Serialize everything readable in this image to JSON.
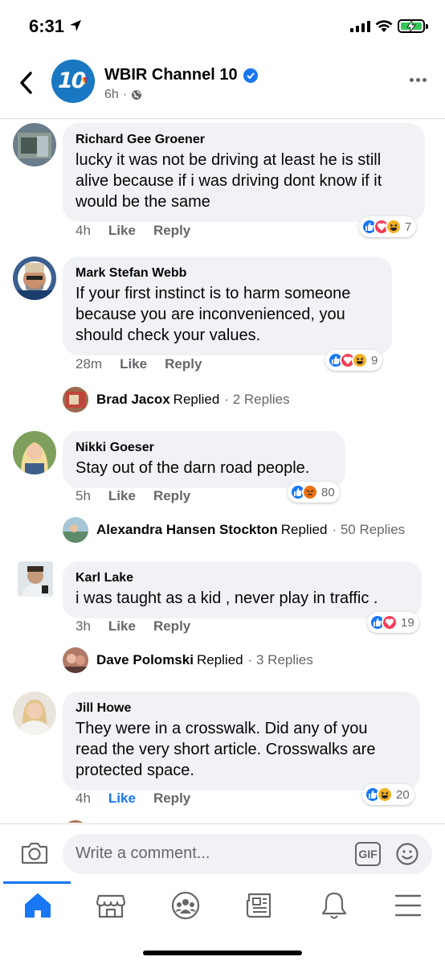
{
  "status": {
    "time": "6:31"
  },
  "header": {
    "page_name": "WBIR Channel 10",
    "avatar_text": "10",
    "time_ago": "6h",
    "separator": "·"
  },
  "comments": [
    {
      "name": "Richard Gee Groener",
      "lines": [
        "lucky it was not be driving at least he is still",
        "alive because if i was driving dont know if it",
        "would be the same"
      ],
      "time": "4h",
      "like": "Like",
      "reply": "Reply",
      "reaction_count": "7"
    },
    {
      "name": "Mark Stefan Webb",
      "lines": [
        "If your first instinct is to harm someone",
        "because you are inconvenienced, you",
        "should check your values."
      ],
      "time": "28m",
      "like": "Like",
      "reply": "Reply",
      "reaction_count": "9",
      "reply_summary": {
        "name": "Brad Jacox",
        "replied": "Replied",
        "count": "· 2 Replies"
      }
    },
    {
      "name": "Nikki Goeser",
      "lines": [
        "Stay out of the darn road people."
      ],
      "time": "5h",
      "like": "Like",
      "reply": "Reply",
      "reaction_count": "80",
      "reply_summary": {
        "name": "Alexandra Hansen Stockton",
        "replied": "Replied",
        "count": "· 50 Replies"
      }
    },
    {
      "name": "Karl Lake",
      "lines": [
        "i was taught as a kid ,  never play in traffic ."
      ],
      "time": "3h",
      "like": "Like",
      "reply": "Reply",
      "reaction_count": "19",
      "reply_summary": {
        "name": "Dave Polomski",
        "replied": "Replied",
        "count": "· 3 Replies"
      }
    },
    {
      "name": "Jill Howe",
      "lines": [
        "They were in a crosswalk.  Did any of you",
        "read the very short article.  Crosswalks are",
        "protected space."
      ],
      "time": "4h",
      "like": "Like",
      "reply": "Reply",
      "reaction_count": "20"
    }
  ],
  "composer": {
    "placeholder": "Write a comment...",
    "gif_label": "GIF"
  },
  "tabs": [
    "home-icon",
    "marketplace-icon",
    "groups-icon",
    "news-icon",
    "notifications-icon",
    "menu-icon"
  ],
  "colors": {
    "accent": "#1877f2",
    "bubble": "#f0f2f5",
    "muted": "#65676b"
  }
}
